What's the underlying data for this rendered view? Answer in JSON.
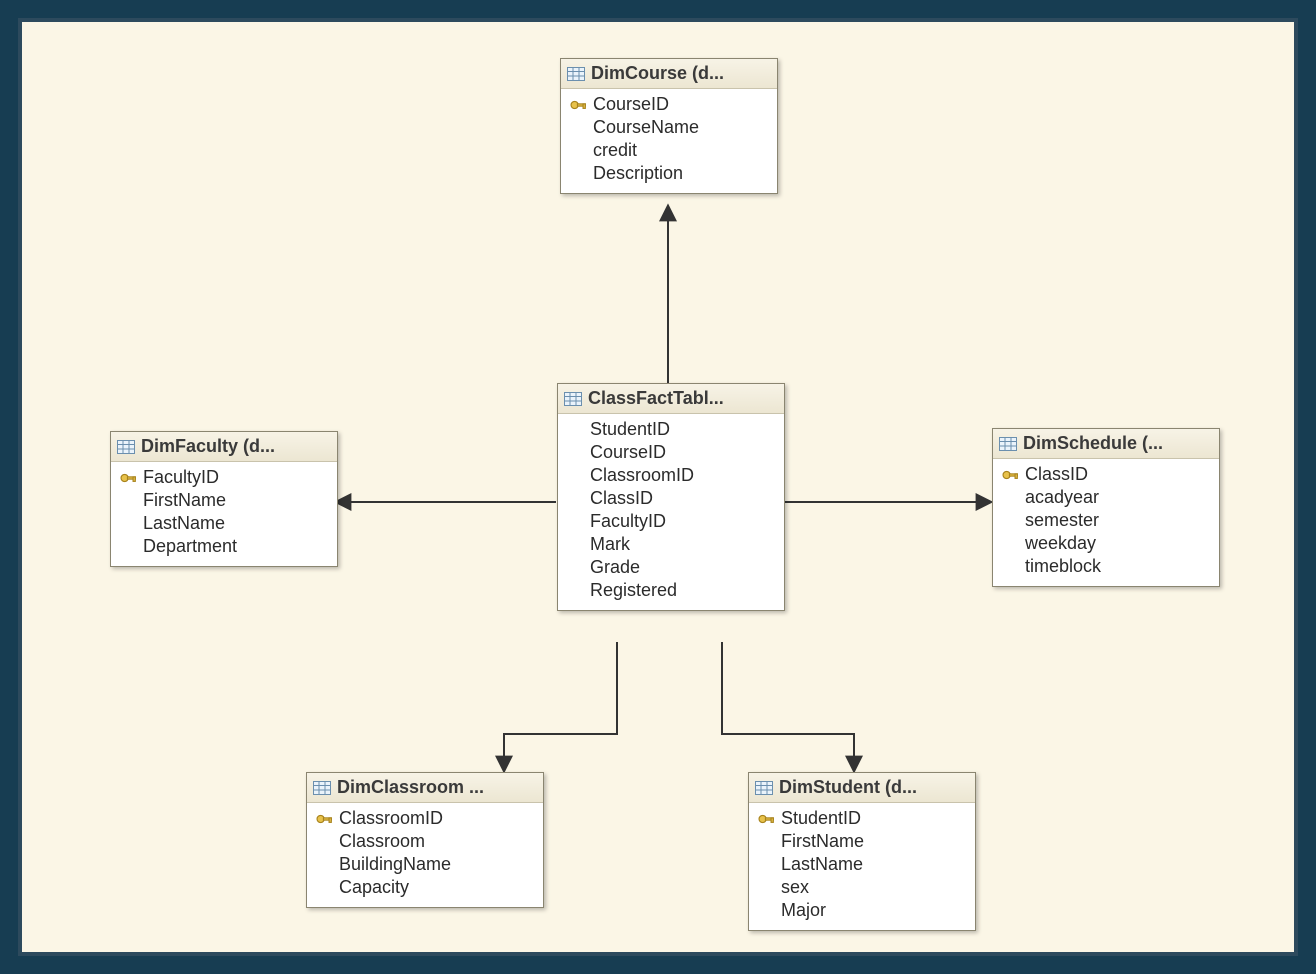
{
  "diagram": {
    "tables": {
      "dim_course": {
        "title": "DimCourse (d...",
        "columns": [
          {
            "name": "CourseID",
            "pk": true
          },
          {
            "name": "CourseName",
            "pk": false
          },
          {
            "name": "credit",
            "pk": false
          },
          {
            "name": "Description",
            "pk": false
          }
        ]
      },
      "dim_faculty": {
        "title": "DimFaculty (d...",
        "columns": [
          {
            "name": "FacultyID",
            "pk": true
          },
          {
            "name": "FirstName",
            "pk": false
          },
          {
            "name": "LastName",
            "pk": false
          },
          {
            "name": "Department",
            "pk": false
          }
        ]
      },
      "class_fact": {
        "title": "ClassFactTabl...",
        "columns": [
          {
            "name": "StudentID",
            "pk": false
          },
          {
            "name": "CourseID",
            "pk": false
          },
          {
            "name": "ClassroomID",
            "pk": false
          },
          {
            "name": "ClassID",
            "pk": false
          },
          {
            "name": "FacultyID",
            "pk": false
          },
          {
            "name": "Mark",
            "pk": false
          },
          {
            "name": "Grade",
            "pk": false
          },
          {
            "name": "Registered",
            "pk": false
          }
        ]
      },
      "dim_schedule": {
        "title": "DimSchedule (...",
        "columns": [
          {
            "name": "ClassID",
            "pk": true
          },
          {
            "name": "acadyear",
            "pk": false
          },
          {
            "name": "semester",
            "pk": false
          },
          {
            "name": "weekday",
            "pk": false
          },
          {
            "name": "timeblock",
            "pk": false
          }
        ]
      },
      "dim_classroom": {
        "title": "DimClassroom ...",
        "columns": [
          {
            "name": "ClassroomID",
            "pk": true
          },
          {
            "name": "Classroom",
            "pk": false
          },
          {
            "name": "BuildingName",
            "pk": false
          },
          {
            "name": "Capacity",
            "pk": false
          }
        ]
      },
      "dim_student": {
        "title": "DimStudent (d...",
        "columns": [
          {
            "name": "StudentID",
            "pk": true
          },
          {
            "name": "FirstName",
            "pk": false
          },
          {
            "name": "LastName",
            "pk": false
          },
          {
            "name": "sex",
            "pk": false
          },
          {
            "name": "Major",
            "pk": false
          }
        ]
      }
    },
    "relationships": [
      {
        "from": "class_fact",
        "to": "dim_course"
      },
      {
        "from": "class_fact",
        "to": "dim_faculty"
      },
      {
        "from": "class_fact",
        "to": "dim_schedule"
      },
      {
        "from": "class_fact",
        "to": "dim_classroom"
      },
      {
        "from": "class_fact",
        "to": "dim_student"
      }
    ]
  }
}
